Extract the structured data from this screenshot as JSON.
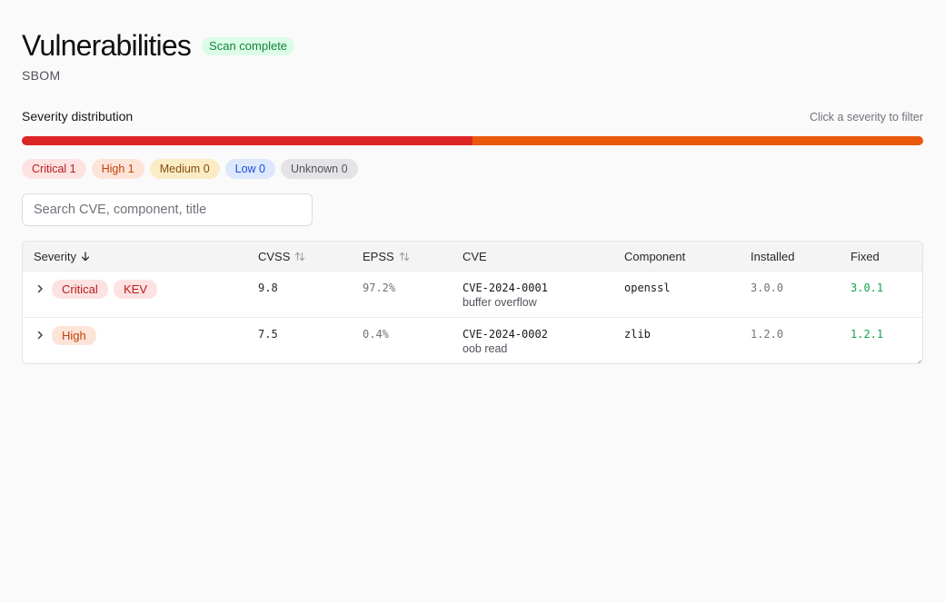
{
  "header": {
    "title": "Vulnerabilities",
    "status": "Scan complete",
    "subtitle": "SBOM"
  },
  "distribution": {
    "label": "Severity distribution",
    "hint": "Click a severity to filter",
    "shares": {
      "critical": 0.5,
      "high": 0.5
    },
    "colors": {
      "critical": "#dc2626",
      "high": "#ea580c"
    },
    "chips": [
      {
        "label": "Critical 1"
      },
      {
        "label": "High 1"
      },
      {
        "label": "Medium 0"
      },
      {
        "label": "Low 0"
      },
      {
        "label": "Unknown 0"
      }
    ]
  },
  "search": {
    "placeholder": "Search CVE, component, title",
    "value": ""
  },
  "table": {
    "columns": {
      "severity": "Severity",
      "cvss": "CVSS",
      "epss": "EPSS",
      "cve": "CVE",
      "component": "Component",
      "installed": "Installed",
      "fixed": "Fixed"
    },
    "rows": [
      {
        "severity": "Critical",
        "kev": "KEV",
        "cvss": "9.8",
        "epss": "97.2%",
        "cve": "CVE-2024-0001",
        "title": "buffer overflow",
        "component": "openssl",
        "installed": "3.0.0",
        "fixed": "3.0.1"
      },
      {
        "severity": "High",
        "cvss": "7.5",
        "epss": "0.4%",
        "cve": "CVE-2024-0002",
        "title": "oob read",
        "component": "zlib",
        "installed": "1.2.0",
        "fixed": "1.2.1"
      }
    ]
  }
}
